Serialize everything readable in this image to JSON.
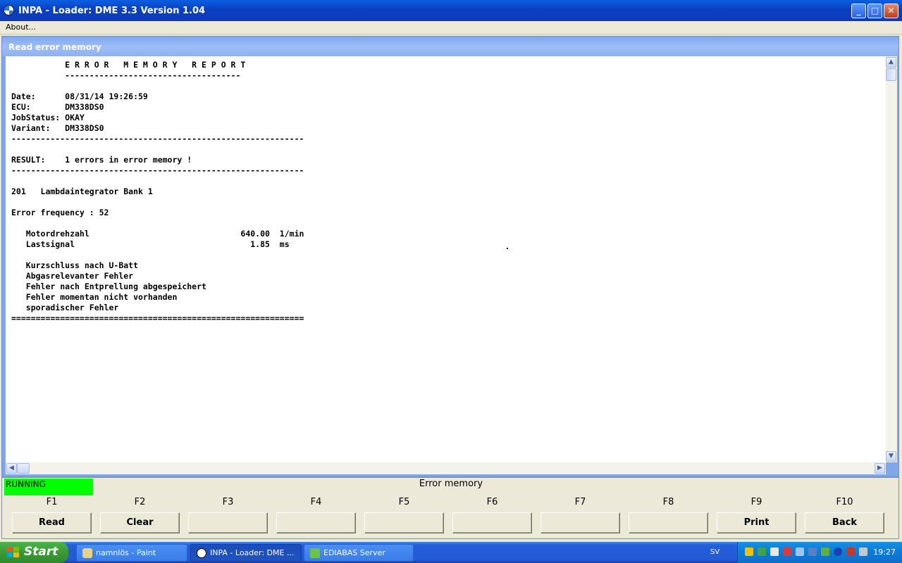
{
  "window": {
    "title": "INPA - Loader:  DME 3.3 Version 1.04",
    "buttons": {
      "minimize": "_",
      "maximize": "□",
      "close": "✕"
    }
  },
  "menu": {
    "about": "About..."
  },
  "child_window": {
    "title": "Read error memory"
  },
  "report": {
    "lines": [
      "           E R R O R   M E M O R Y   R E P O R T",
      "           ------------------------------------",
      "",
      "Date:      08/31/14 19:26:59",
      "ECU:       DM338DS0",
      "JobStatus: OKAY",
      "Variant:   DM338DS0",
      "------------------------------------------------------------",
      "",
      "RESULT:    1 errors in error memory !",
      "------------------------------------------------------------",
      "",
      "201   Lambdaintegrator Bank 1",
      "",
      "Error frequency : 52",
      "",
      "   Motordrehzahl                               640.00  1/min",
      "   Lastsignal                                    1.85  ms",
      "",
      "   Kurzschluss nach U-Batt",
      "   Abgasrelevanter Fehler",
      "   Fehler nach Entprellung abgespeichert",
      "   Fehler momentan nicht vorhanden",
      "   sporadischer Fehler",
      "============================================================"
    ]
  },
  "scrollbar": {
    "up": "▲",
    "down": "▼",
    "left": "◀",
    "right": "▶"
  },
  "status": {
    "running": "RUNNING",
    "running_color": "#00FF00",
    "caption": "Error memory"
  },
  "function_keys": [
    {
      "key": "F1",
      "label": "Read"
    },
    {
      "key": "F2",
      "label": "Clear"
    },
    {
      "key": "F3",
      "label": ""
    },
    {
      "key": "F4",
      "label": ""
    },
    {
      "key": "F5",
      "label": ""
    },
    {
      "key": "F6",
      "label": ""
    },
    {
      "key": "F7",
      "label": ""
    },
    {
      "key": "F8",
      "label": ""
    },
    {
      "key": "F9",
      "label": "Print"
    },
    {
      "key": "F10",
      "label": "Back"
    }
  ],
  "taskbar": {
    "start": "Start",
    "tasks": [
      {
        "label": "namnlös - Paint",
        "icon": "paint-icon"
      },
      {
        "label": "INPA - Loader:  DME ...",
        "icon": "bmw-icon",
        "active": true
      },
      {
        "label": "EDIABAS Server",
        "icon": "ediabas-icon"
      }
    ],
    "language": "SV",
    "clock": "19:27"
  }
}
